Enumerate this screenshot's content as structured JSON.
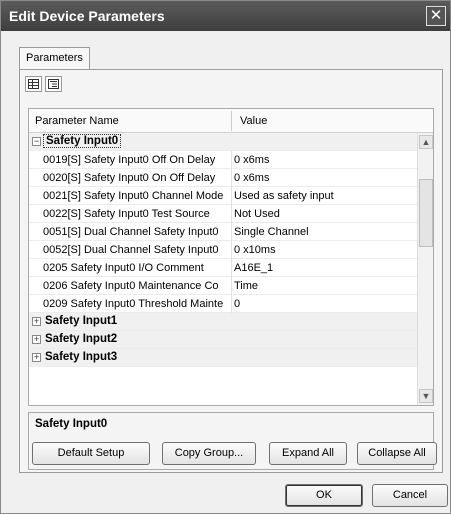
{
  "window": {
    "title": "Edit Device Parameters",
    "close_glyph": "✕"
  },
  "tabs": [
    {
      "label": "Parameters"
    }
  ],
  "toolbar": {
    "list_view_icon": "list-view-icon",
    "detail_view_icon": "detail-view-icon"
  },
  "grid": {
    "columns": {
      "name": "Parameter Name",
      "value": "Value"
    },
    "rows": [
      {
        "type": "group",
        "expander": "−",
        "label": "Safety Input0"
      },
      {
        "type": "param",
        "name": "0019[S] Safety Input0 Off On Delay",
        "value": "0 x6ms"
      },
      {
        "type": "param",
        "name": "0020[S] Safety Input0 On Off Delay",
        "value": "0 x6ms"
      },
      {
        "type": "param",
        "name": "0021[S] Safety Input0 Channel Mode",
        "value": "Used as safety input"
      },
      {
        "type": "param",
        "name": "0022[S] Safety Input0 Test Source",
        "value": "Not Used"
      },
      {
        "type": "param",
        "name": "0051[S] Dual Channel Safety Input0",
        "value": "Single Channel"
      },
      {
        "type": "param",
        "name": "0052[S] Dual Channel Safety Input0",
        "value": "0 x10ms"
      },
      {
        "type": "param",
        "name": "0205 Safety Input0 I/O Comment",
        "value": "A16E_1"
      },
      {
        "type": "param",
        "name": "0206 Safety Input0 Maintenance Co",
        "value": "Time"
      },
      {
        "type": "param",
        "name": "0209 Safety Input0 Threshold Mainte",
        "value": "0"
      },
      {
        "type": "group",
        "expander": "+",
        "label": "Safety Input1"
      },
      {
        "type": "group",
        "expander": "+",
        "label": "Safety Input2"
      },
      {
        "type": "group",
        "expander": "+",
        "label": "Safety Input3"
      }
    ]
  },
  "description": {
    "title": "Safety Input0"
  },
  "buttons": {
    "default_setup": "Default Setup",
    "copy_group": "Copy Group...",
    "expand_all": "Expand All",
    "collapse_all": "Collapse All",
    "ok": "OK",
    "cancel": "Cancel"
  },
  "colors": {
    "titlebar": "#4a4a4a",
    "panel": "#f0f0f0",
    "group_row": "#f0f0f0"
  }
}
